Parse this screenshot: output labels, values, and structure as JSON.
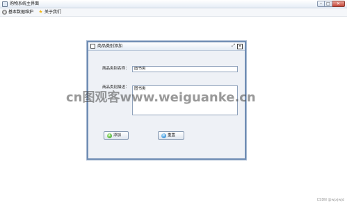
{
  "window": {
    "title": "购物系统主界面",
    "controls": {
      "minimize": "–",
      "maximize": "□",
      "close": "✕"
    }
  },
  "menubar": {
    "items": [
      {
        "label": "基本数据维护",
        "icon": "gear-icon"
      },
      {
        "label": "关于我们",
        "icon": "star-icon"
      }
    ]
  },
  "internal_frame": {
    "title": "商品类别添加",
    "restore_symbol": "⤢",
    "close_symbol": "×",
    "form": {
      "name_label": "商品类别名称：",
      "name_value": "图书类",
      "desc_label": "商品类别描述：",
      "desc_value": "图书类"
    },
    "buttons": {
      "add_label": "添加",
      "reset_label": "重置"
    }
  },
  "watermark": "cn图观客www.weiguanke.cn",
  "credit": "CSDN @wjxjwjd",
  "colors": {
    "frame_border": "#6f8db4",
    "accent_add": "#2f9b1f",
    "accent_reset": "#1d7bc8"
  }
}
